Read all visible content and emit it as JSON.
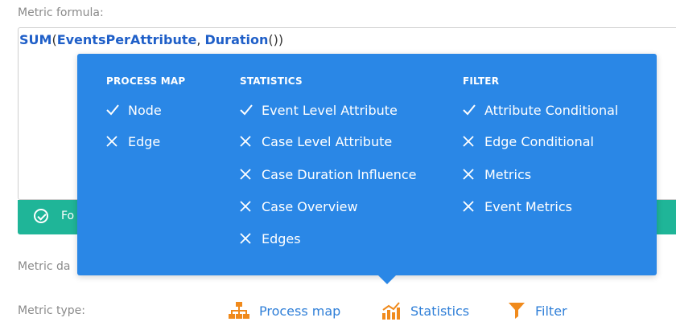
{
  "formula": {
    "label": "Metric formula:",
    "func": "SUM",
    "open_paren": "(",
    "arg1": "EventsPerAttribute",
    "separator": ", ",
    "arg2": "Duration",
    "close": "())"
  },
  "status": {
    "text": "Fo",
    "icon": "check-circle-icon",
    "color": "#1fb598"
  },
  "metric_date_label": "Metric da",
  "metric_type": {
    "label": "Metric type:",
    "options": [
      {
        "label": "Process map",
        "icon": "process-map-icon"
      },
      {
        "label": "Statistics",
        "icon": "statistics-icon"
      },
      {
        "label": "Filter",
        "icon": "filter-icon"
      }
    ]
  },
  "popover": {
    "background": "#2a87e6",
    "columns": [
      {
        "heading": "PROCESS MAP",
        "items": [
          {
            "label": "Node",
            "supported": true
          },
          {
            "label": "Edge",
            "supported": false
          }
        ]
      },
      {
        "heading": "STATISTICS",
        "items": [
          {
            "label": "Event Level Attribute",
            "supported": true
          },
          {
            "label": "Case Level Attribute",
            "supported": false
          },
          {
            "label": "Case Duration Influence",
            "supported": false
          },
          {
            "label": "Case Overview",
            "supported": false
          },
          {
            "label": "Edges",
            "supported": false
          }
        ]
      },
      {
        "heading": "FILTER",
        "items": [
          {
            "label": "Attribute Conditional",
            "supported": true
          },
          {
            "label": "Edge Conditional",
            "supported": false
          },
          {
            "label": "Metrics",
            "supported": false
          },
          {
            "label": "Event Metrics",
            "supported": false
          }
        ]
      }
    ]
  }
}
